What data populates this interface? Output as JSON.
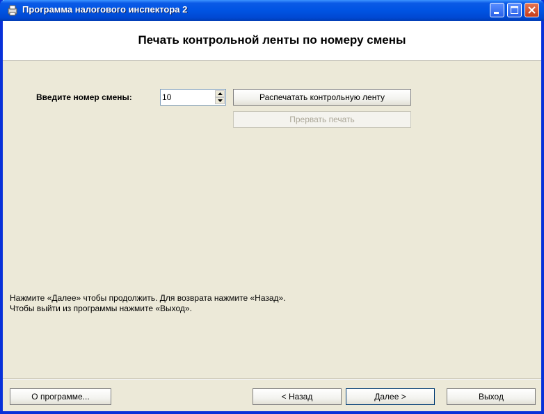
{
  "window": {
    "title": "Программа налогового инспектора 2"
  },
  "header": {
    "title": "Печать контрольной ленты по номеру смены"
  },
  "shift": {
    "label": "Введите номер смены:",
    "value": "10"
  },
  "actions": {
    "print_label": "Распечатать контрольную ленту",
    "stop_label": "Прервать печать"
  },
  "hints": {
    "line1": "Нажмите «Далее» чтобы продолжить. Для возврата нажмите «Назад».",
    "line2": "Чтобы выйти из программы нажмите «Выход»."
  },
  "footer": {
    "about_label": "О программе...",
    "back_label": "< Назад",
    "next_label": "Далее >",
    "exit_label": "Выход"
  },
  "colors": {
    "titlebar": "#0054e3",
    "face": "#ece9d8",
    "close": "#c63b19"
  }
}
